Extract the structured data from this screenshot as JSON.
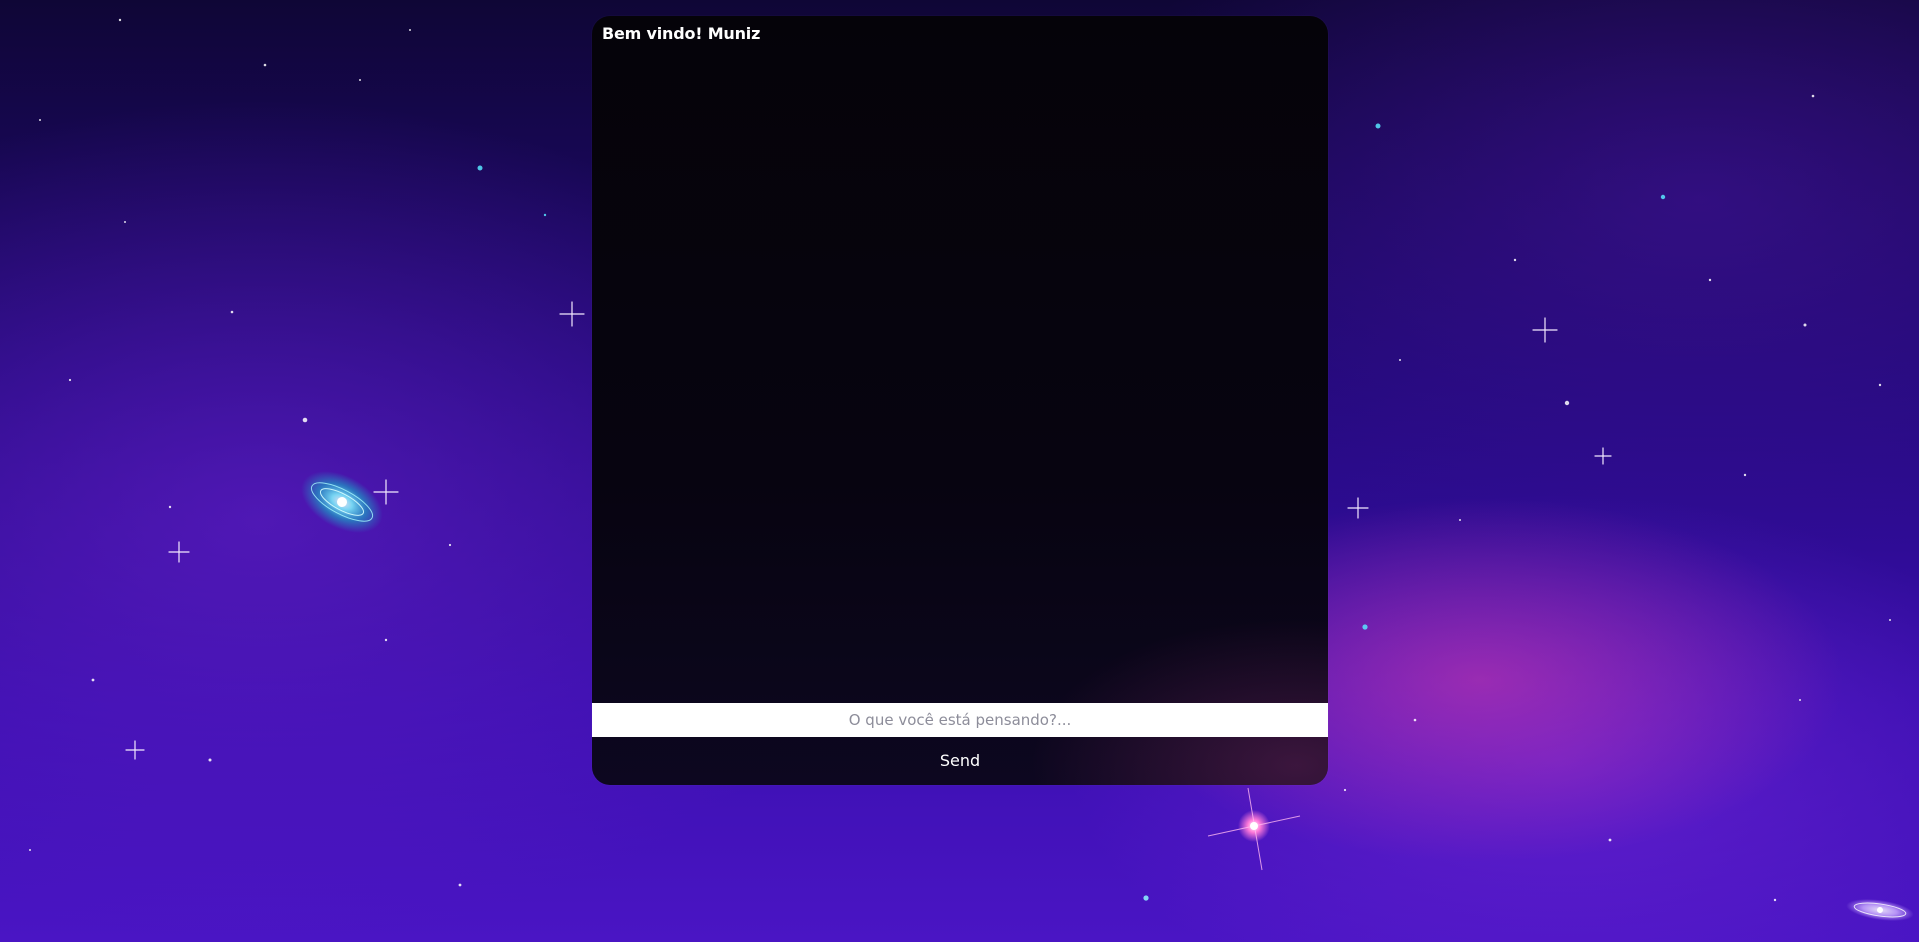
{
  "header": {
    "welcome_text": "Bem vindo! Muniz"
  },
  "composer": {
    "placeholder": "O que você está pensando?...",
    "value": "",
    "send_label": "Send"
  },
  "colors": {
    "panel_background": "#050309",
    "input_background": "#ffffff",
    "text_primary": "#ffffff",
    "placeholder_text": "#8d8d9a",
    "space_background": "#2a0c8a"
  },
  "messages": []
}
